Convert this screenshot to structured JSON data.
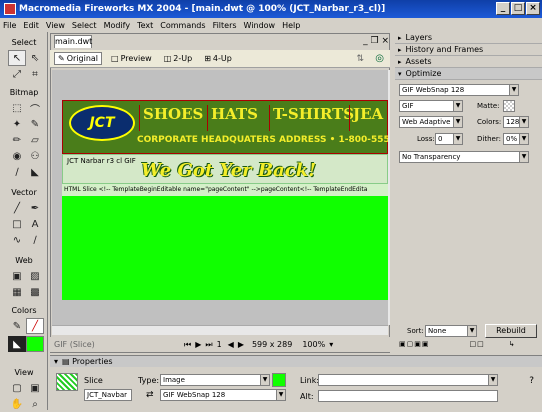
{
  "window": {
    "title": "Macromedia Fireworks MX 2004 - [main.dwt @ 100% (JCT_Narbar_r3_cl)]",
    "min": "_",
    "max": "□",
    "close": "×"
  },
  "menu": [
    "File",
    "Edit",
    "View",
    "Select",
    "Modify",
    "Text",
    "Commands",
    "Filters",
    "Window",
    "Help"
  ],
  "tools": {
    "select": "Select",
    "bitmap": "Bitmap",
    "vector": "Vector",
    "web": "Web",
    "colors": "Colors",
    "view": "View"
  },
  "document": {
    "tab": "main.dwt",
    "views": [
      "Original",
      "Preview",
      "2-Up",
      "4-Up"
    ],
    "banner": {
      "logo": "JCT",
      "nav": [
        "SHOES",
        "HATS",
        "T-SHIRTS",
        "JEA"
      ],
      "hq": "CORPORATE HEADQUATERS ADDRESS • 1-800-555-10"
    },
    "slice_label": "JCT  Narbar r3  cl  GIF",
    "tagline": "We Got Yer Back!",
    "html_slice": "HTML Slice <!-- TemplateBeginEditable name=\"pageContent\" -->pageContent<!-- TemplateEndEdita"
  },
  "status": {
    "format": "GIF (Slice)",
    "page": "1",
    "size": "599 x 289",
    "zoom": "100%"
  },
  "panels": {
    "layers": "Layers",
    "history": "History and Frames",
    "assets": "Assets",
    "optimize": "Optimize"
  },
  "optimize": {
    "preset": "GIF WebSnap 128",
    "format": "GIF",
    "matte_label": "Matte:",
    "palette": "Web Adaptive",
    "colors_label": "Colors:",
    "colors": "128",
    "loss_label": "Loss:",
    "loss": "0",
    "dither_label": "Dither:",
    "dither": "0%",
    "transparency": "No Transparency"
  },
  "swatch": {
    "sort_label": "Sort:",
    "sort": "None",
    "rebuild": "Rebuild"
  },
  "properties": {
    "header": "Properties",
    "kind": "Slice",
    "name": "JCT_Navbar",
    "type_label": "Type:",
    "type": "Image",
    "export_preset": "GIF WebSnap 128",
    "link_label": "Link:",
    "alt_label": "Alt:"
  }
}
